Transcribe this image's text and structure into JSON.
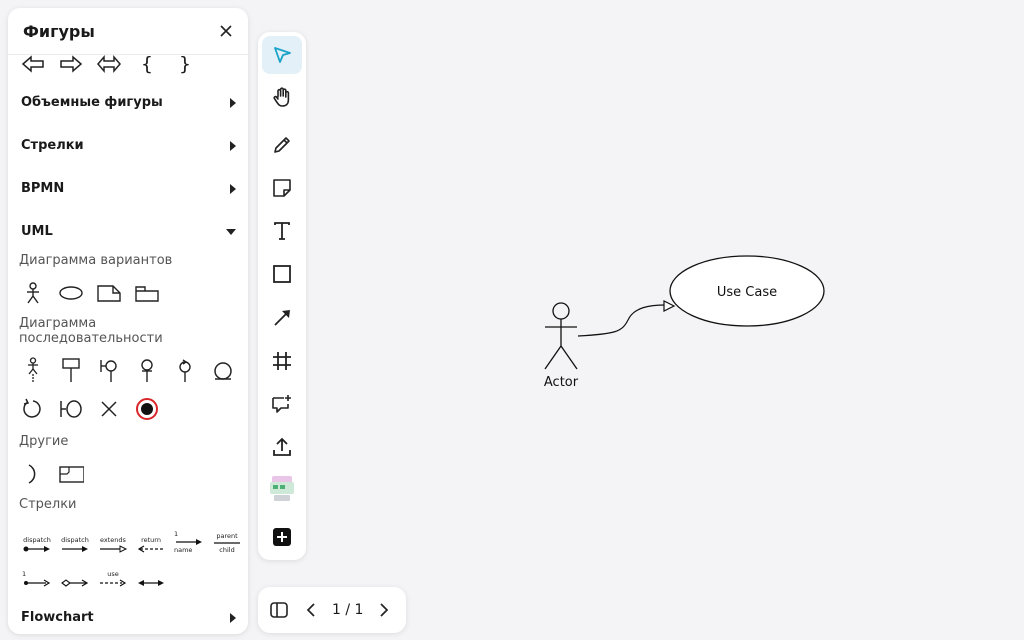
{
  "panel": {
    "title": "Фигуры",
    "sections": {
      "volumetric": "Объемные фигуры",
      "arrows": "Стрелки",
      "bpmn": "BPMN",
      "uml": "UML",
      "flowchart": "Flowchart"
    },
    "uml": {
      "use_case_heading": "Диаграмма вариантов",
      "sequence_heading": "Диаграмма последовательности",
      "other_heading": "Другие",
      "arrows_heading": "Стрелки",
      "arrow_labels": {
        "dispatch1": "dispatch",
        "dispatch2": "dispatch",
        "extends": "extends",
        "return": "return",
        "one": "1",
        "name": "name",
        "parent": "parent",
        "child": "child",
        "one_b": "1",
        "use": "use"
      }
    },
    "braces": {
      "open": "{",
      "close": "}"
    }
  },
  "canvas": {
    "actor_label": "Actor",
    "use_case_label": "Use Case"
  },
  "pager": {
    "count": "1 / 1"
  },
  "colors": {
    "accent": "#1aa3c8",
    "active_tool_bg": "#e3f0f7",
    "record_ring": "#d9262b"
  }
}
